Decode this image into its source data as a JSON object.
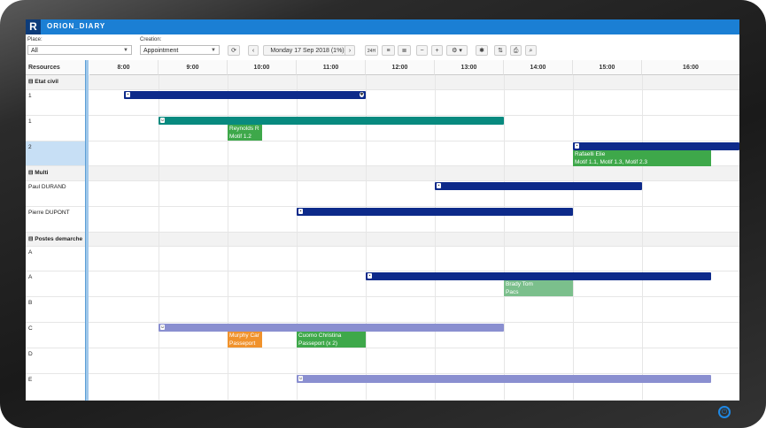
{
  "app": {
    "logo": "R",
    "title": "ORION_DIARY"
  },
  "filters": {
    "place_label": "Place:",
    "place_value": "All",
    "creation_label": "Creation:",
    "creation_value": "Appointment"
  },
  "toolbar": {
    "refresh_icon": "refresh-icon",
    "prev": "‹",
    "date_label": "Monday 17 Sep 2018 (1%)",
    "next": "›",
    "view_24h": "24H",
    "zoom_out": "−",
    "zoom_in": "+",
    "settings": "⚙ ▾",
    "print_icon": "printer-icon",
    "search_icon": "search-icon"
  },
  "grid": {
    "resources_header": "Resources",
    "hours": [
      "8:00",
      "9:00",
      "10:00",
      "11:00",
      "12:00",
      "13:00",
      "14:00",
      "15:00",
      "16:00"
    ]
  },
  "rows": [
    {
      "label": "⊟ Etat civil",
      "group": true
    },
    {
      "label": "1"
    },
    {
      "label": "1"
    },
    {
      "label": "2",
      "selected": true
    },
    {
      "label": "⊟ Multi",
      "group": true
    },
    {
      "label": "Paul DURAND"
    },
    {
      "label": "Pierre DUPONT"
    },
    {
      "label": "⊟ Postes demarche",
      "group": true
    },
    {
      "label": "A"
    },
    {
      "label": "A"
    },
    {
      "label": "B"
    },
    {
      "label": "C"
    },
    {
      "label": "D"
    },
    {
      "label": "E"
    }
  ],
  "colors": {
    "navy": "#0d2a8a",
    "teal": "#088a7f",
    "green": "#3ea84a",
    "lightgreen": "#7bbf8c",
    "orange": "#f0922c",
    "lavender": "#8a8fd0"
  },
  "appointments": {
    "reynolds": {
      "line1": "Reynolds R",
      "line2": "Motif 1.2"
    },
    "rafaelli": {
      "line1": "Rafaelli Elie",
      "line2": "Motif 1.1, Motif 1.3, Motif 2.3"
    },
    "brady": {
      "line1": "Brady Tom",
      "line2": "Pacs"
    },
    "murphy": {
      "line1": "Murphy Car",
      "line2": "Passeport"
    },
    "cuomo": {
      "line1": "Cuomo Christina",
      "line2": "Passeport (x 2)"
    }
  }
}
